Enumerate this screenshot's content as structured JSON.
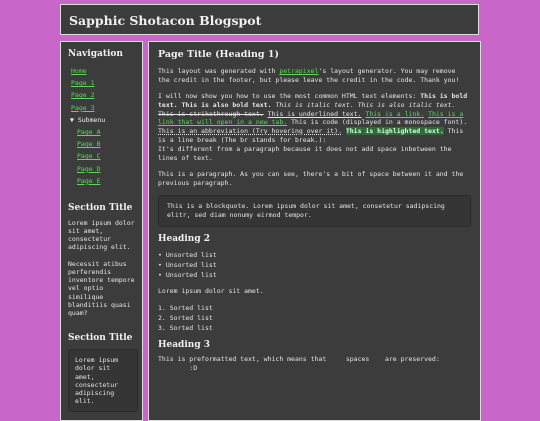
{
  "site_title": "Sapphic Shotacon Blogspot",
  "sidebar": {
    "nav_heading": "Navigation",
    "nav": [
      {
        "label": "Home",
        "type": "link"
      },
      {
        "label": "Page 1",
        "type": "link"
      },
      {
        "label": "Page 2",
        "type": "link"
      },
      {
        "label": "Page 3",
        "type": "link"
      },
      {
        "label": "▼ Submenu",
        "type": "submenu"
      },
      {
        "label": "Page A",
        "type": "sublink"
      },
      {
        "label": "Page B",
        "type": "sublink"
      },
      {
        "label": "Page C",
        "type": "sublink"
      },
      {
        "label": "Page D",
        "type": "sublink"
      },
      {
        "label": "Page E",
        "type": "sublink"
      }
    ],
    "section1": {
      "heading": "Section Title",
      "p1": "Lorem ipsum dolor sit amet, consectetur adipiscing elit.",
      "p2": "Necessit atibus perferendis inventore tempore vel optio similique blanditiis quasi quam?"
    },
    "section2": {
      "heading": "Section Title",
      "box": "Lorem ipsum dolor sit amet, consectetur adipiscing elit."
    }
  },
  "main": {
    "h2": "Page Title (Heading 1)",
    "intro": {
      "pre": "This layout was generated with ",
      "link": "petrapixel",
      "post": "'s layout generator. You may remove the credit in the footer, but please leave the credit in the code. Thank you!"
    },
    "elements": {
      "t1": "I will now show you how to use the most common HTML text elements: ",
      "bold1": "This is bold text.",
      "bold2": "This is also bold text.",
      "italic1": "This is italic text.",
      "italic2": "This is also italic text.",
      "strike": "This is strikethrough text.",
      "underline": "This is underlined text.",
      "link1": "This is a link.",
      "link2": "This is a link that will open in a new tab.",
      "code": "This is code (displayed in a monospace font).",
      "abbr": "This is an abbreviation (Try hovering over it).",
      "highlight": "This is highlighted text.",
      "linebreak": "This is a line break (The br stands for break.):",
      "after_br": "It's different from a paragraph because it does not add space inbetween the lines of text."
    },
    "para": "This is a paragraph. As you can see, there's a bit of space between it and the previous paragraph.",
    "blockquote": "This is a blockquote. Lorem ipsum dolor sit amet, consetetur sadipscing elitr, sed diam nonumy eirmod tempor.",
    "h2b": "Heading 2",
    "ul": [
      "• Unsorted list",
      "• Unsorted list",
      "• Unsorted list"
    ],
    "lorem": "Lorem ipsum dolor sit amet.",
    "ol": [
      "1. Sorted list",
      "2. Sorted list",
      "3. Sorted list"
    ],
    "h3": "Heading 3",
    "pre": "This is preformatted text, which means that     spaces    are preserved:\n        :D"
  }
}
